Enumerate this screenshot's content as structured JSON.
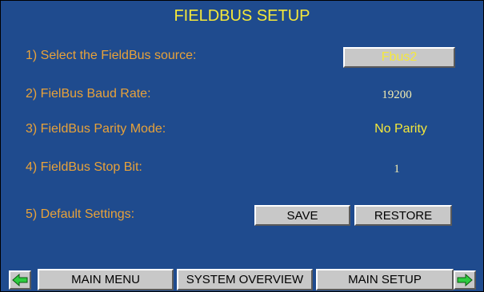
{
  "title": "FIELDBUS SETUP",
  "rows": [
    {
      "label": "1) Select the FieldBus source:",
      "value": "Fbus2"
    },
    {
      "label": "2) FielBus Baud Rate:",
      "value": "19200"
    },
    {
      "label": "3) FieldBus Parity Mode:",
      "value": "No Parity"
    },
    {
      "label": "4) FieldBus Stop Bit:",
      "value": "1"
    },
    {
      "label": "5) Default Settings:"
    }
  ],
  "buttons": {
    "save": "SAVE",
    "restore": "RESTORE"
  },
  "nav": {
    "main_menu": "MAIN MENU",
    "system_overview": "SYSTEM OVERVIEW",
    "main_setup": "MAIN SETUP",
    "prev_icon": "arrow-left-icon",
    "next_icon": "arrow-right-icon"
  },
  "colors": {
    "background": "#1f4b8e",
    "title": "#f5e83a",
    "label": "#e8a23a",
    "button": "#c8c8c8",
    "arrow": "#2ecc40"
  }
}
